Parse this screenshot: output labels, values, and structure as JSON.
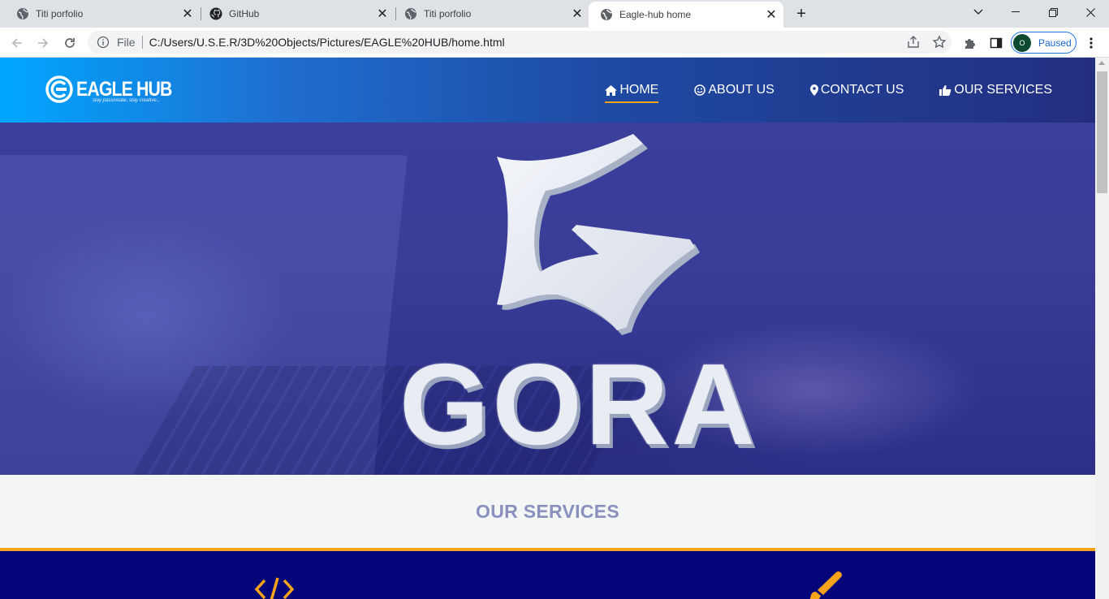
{
  "browser": {
    "tabs": [
      {
        "title": "Titi porfolio",
        "icon": "globe-icon",
        "active": false
      },
      {
        "title": "GitHub",
        "icon": "github-icon",
        "active": false
      },
      {
        "title": "Titi porfolio",
        "icon": "globe-icon",
        "active": false
      },
      {
        "title": "Eagle-hub home",
        "icon": "globe-icon",
        "active": true
      }
    ],
    "omnibox": {
      "scheme": "File",
      "url": "C:/Users/U.S.E.R/3D%20Objects/Pictures/EAGLE%20HUB/home.html"
    },
    "profile": {
      "initial": "O",
      "status": "Paused"
    }
  },
  "site": {
    "logo": {
      "brand": "EAGLE HUB",
      "tagline": "stay passionate, stay creative..."
    },
    "nav": [
      {
        "label": "HOME",
        "icon": "home-icon",
        "active": true
      },
      {
        "label": "ABOUT US",
        "icon": "smile-icon",
        "active": false
      },
      {
        "label": "CONTACT US",
        "icon": "map-pin-icon",
        "active": false
      },
      {
        "label": "OUR SERVICES",
        "icon": "thumbs-up-icon",
        "active": false
      }
    ],
    "hero": {
      "logo_text": "GORA"
    },
    "services": {
      "title": "OUR SERVICES",
      "icons": [
        "code-icon",
        "paintbrush-icon"
      ]
    }
  },
  "colors": {
    "accent": "#f7a21b",
    "header_start": "#00a7ff",
    "header_end": "#232e7f",
    "services_band": "#030578",
    "services_title": "#8a90bd"
  }
}
